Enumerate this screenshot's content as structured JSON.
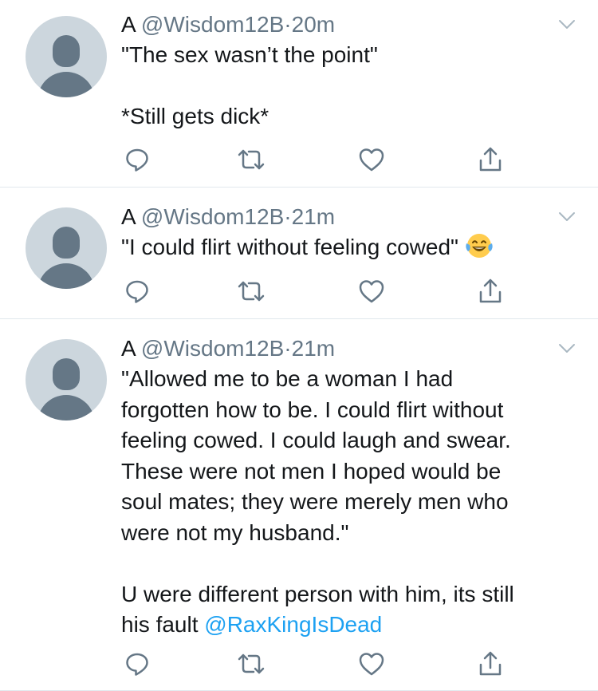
{
  "colors": {
    "text": "#14171a",
    "secondary": "#657786",
    "link": "#1da1f2",
    "divider": "#e1e8ed",
    "avatar_bg": "#ccd6dd"
  },
  "icons": [
    "reply-icon",
    "retweet-icon",
    "like-icon",
    "share-icon",
    "chevron-down-icon",
    "avatar-placeholder-icon",
    "laughing-emoji-icon"
  ],
  "tweets": [
    {
      "name": "A",
      "handle": "@Wisdom12B",
      "separator": "·",
      "time": "20m",
      "text": "\"The sex wasn’t the point\"\n\n*Still gets dick*"
    },
    {
      "name": "A",
      "handle": "@Wisdom12B",
      "separator": "·",
      "time": "21m",
      "text": "\"I could flirt without feeling cowed\""
    },
    {
      "name": "A",
      "handle": "@Wisdom12B",
      "separator": "·",
      "time": "21m",
      "text": "\"Allowed me to be a woman I had\nforgotten how to be. I could flirt without\nfeeling cowed. I could laugh and swear.\nThese were not men I hoped would be\nsoul mates; they were merely men who\nwere not my husband.\"\n\nU were different person with him, its still\nhis fault ",
      "mention": "@RaxKingIsDead"
    }
  ]
}
